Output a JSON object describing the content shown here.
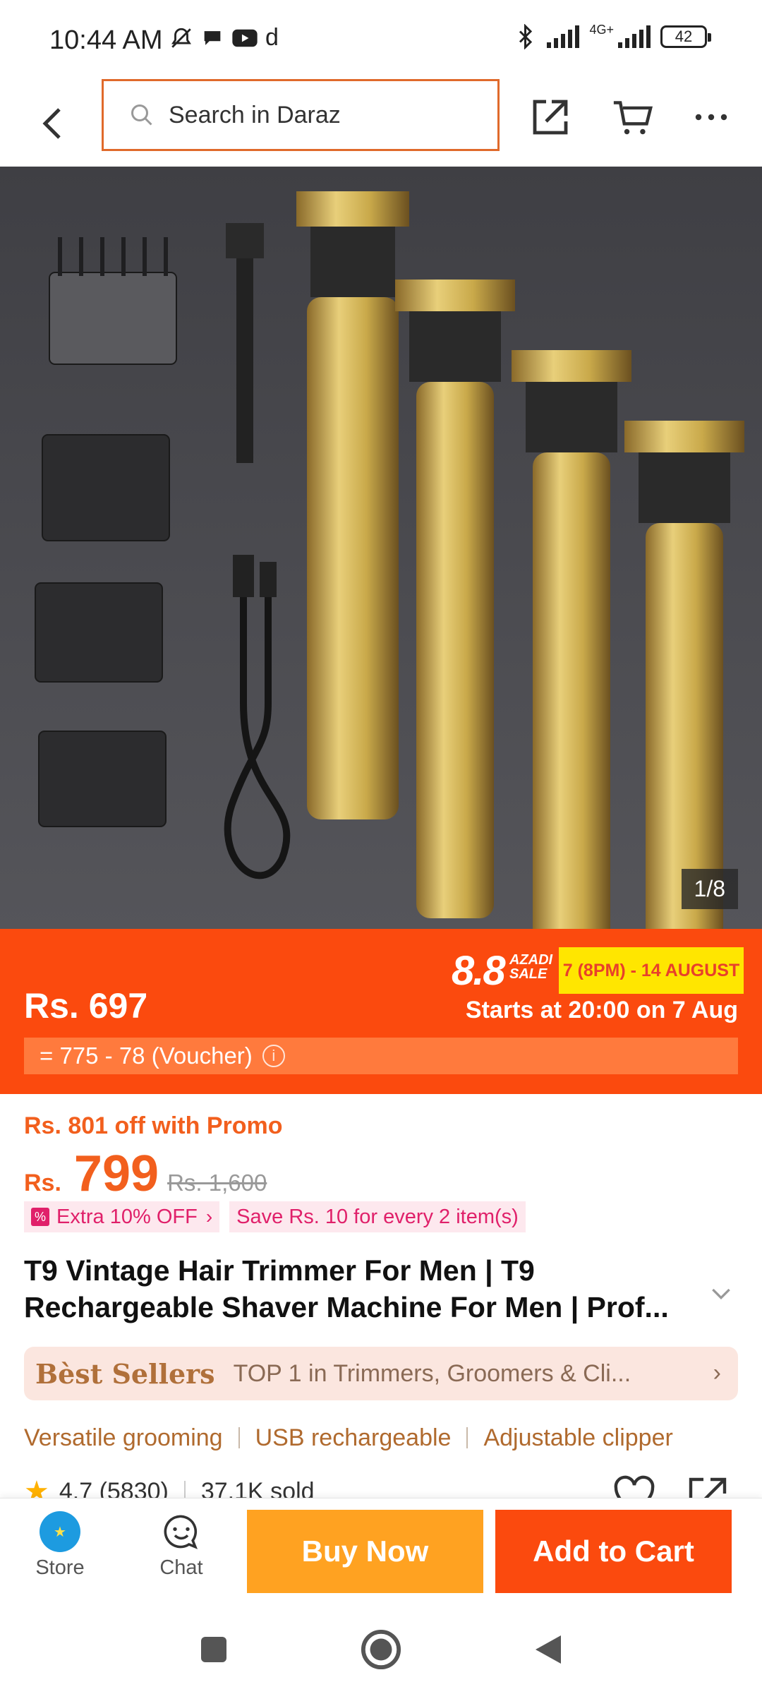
{
  "status": {
    "time": "10:44 AM",
    "network": "4G+",
    "battery": "42",
    "left_icons": [
      "mute-icon",
      "chat-bubble-icon",
      "youtube-icon",
      "daraz-d-icon"
    ],
    "app_glyph": "d"
  },
  "header": {
    "search_placeholder": "Search in Daraz",
    "icons": [
      "back-arrow-icon",
      "share-icon",
      "cart-icon",
      "more-icon"
    ]
  },
  "gallery": {
    "counter": "1/8"
  },
  "banner": {
    "sale_big": "8.8",
    "sale_small_1": "AZADI",
    "sale_small_2": "SALE",
    "sale_dates": "7 (8PM) - 14 AUGUST",
    "price": "Rs. 697",
    "starts": "Starts at 20:00 on 7 Aug",
    "voucher": "= 775 - 78 (Voucher)"
  },
  "promo": {
    "text": "Rs. 801 off with Promo",
    "currency": "Rs.",
    "price": "799",
    "old_price": "Rs. 1,600",
    "tags": [
      "Extra 10% OFF",
      "Save Rs. 10 for every 2 item(s)"
    ]
  },
  "product": {
    "title": "T9 Vintage Hair Trimmer For Men | T9 Rechargeable Shaver Machine For Men | Prof..."
  },
  "bestsellers": {
    "label": "Bèst Sellers",
    "text": "TOP 1 in Trimmers, Groomers & Cli..."
  },
  "highlights": [
    "Versatile grooming",
    "USB rechargeable",
    "Adjustable clipper"
  ],
  "rating": {
    "score": "4.7 (5830)",
    "sold": "37.1K sold"
  },
  "bottom": {
    "store": "Store",
    "chat": "Chat",
    "buy_now": "Buy Now",
    "add_to_cart": "Add to Cart"
  },
  "colors": {
    "brand_orange": "#fb4a0e",
    "buy_yellow": "#ffa221",
    "promo_orange": "#f25f1d",
    "sale_yellow": "#ffe600"
  }
}
